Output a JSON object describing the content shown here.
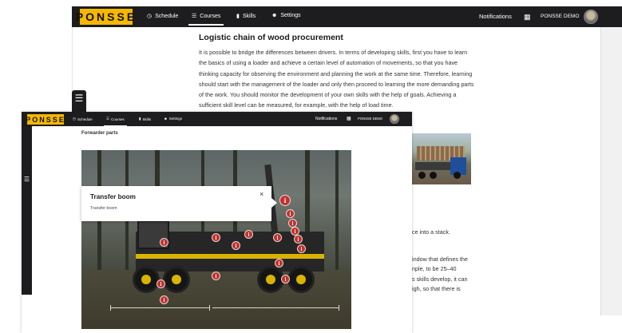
{
  "brand": {
    "logo_text": "PONSSE",
    "logo_color": "#f5b800",
    "navbar_color": "#1d1d1f"
  },
  "nav": {
    "schedule": "Schedule",
    "courses": "Courses",
    "skills": "Skills",
    "settings": "Settings",
    "notifications": "Notifications",
    "org": "PONSSE DEMO"
  },
  "icons": {
    "schedule": "clock-icon",
    "courses": "list-icon",
    "skills": "bar-chart-icon",
    "settings": "user-plus-icon",
    "apps": "grid-icon",
    "sidebar": "list-icon",
    "hotspot": "info-icon",
    "close": "close-icon"
  },
  "back_article": {
    "title": "Logistic chain of wood procurement",
    "body": "It is possible to bridge the differences between drivers. In terms of developing skills, first you have to learn the basics of using a loader and achieve a certain level of automation of movements, so that you have thinking capacity for observing the environment and planning the work at the same time. Therefore, learning should start with the management of the loader and only then proceed to learning the more demanding parts of the work. You should monitor the development of your own skills with the help of goals. Achieving a sufficient skill level can be measured, for example, with the help of load time.",
    "fragments": [
      "ce into a stack.",
      "indow that defines the",
      "nple, to be 25–40",
      "s skills develop, it can",
      "igh, so that there is"
    ]
  },
  "front": {
    "page_title": "Forwarder parts",
    "hotspot_symbol": "i",
    "popover": {
      "title": "Transfer boom",
      "text": "Transfer boom",
      "close_symbol": "×"
    }
  }
}
